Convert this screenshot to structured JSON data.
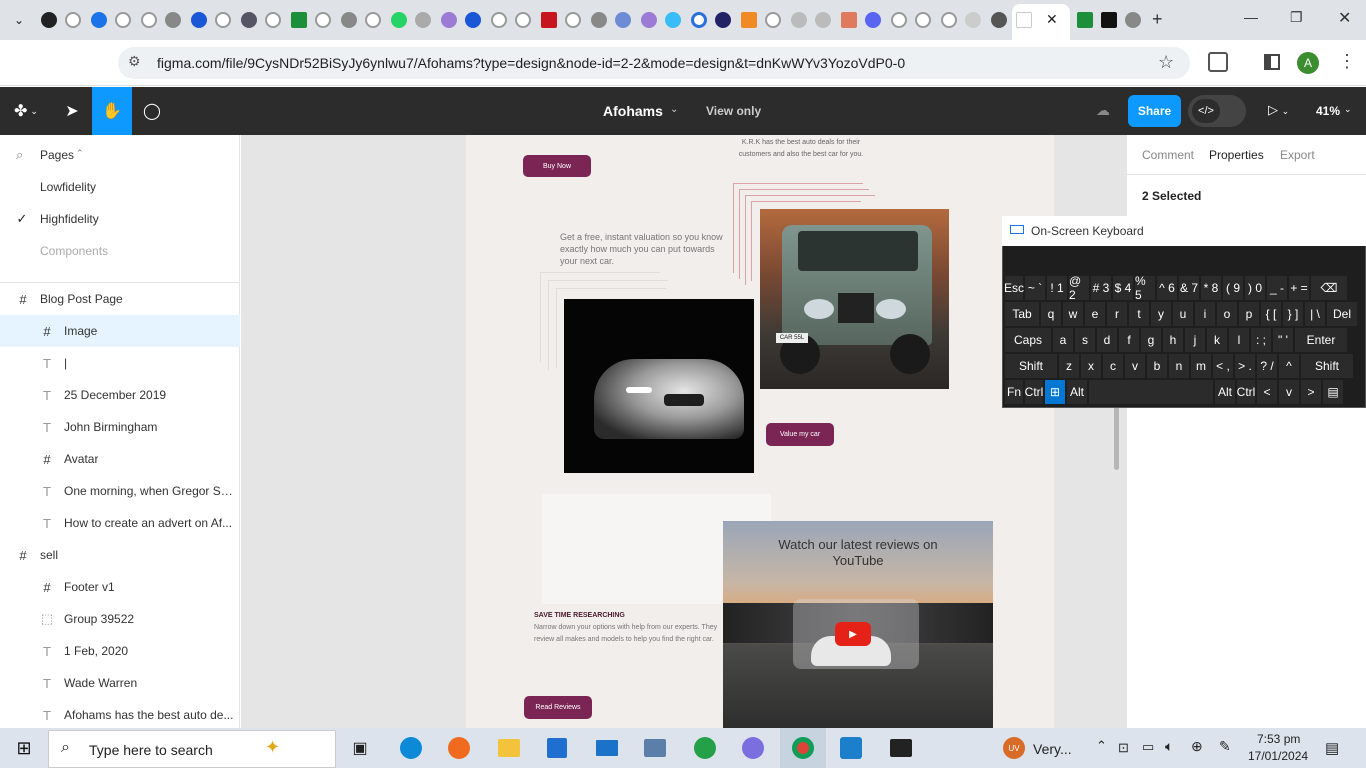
{
  "browser": {
    "url": "figma.com/file/9CysNDr52BiSyJy6ynlwu7/Afohams?type=design&node-id=2-2&mode=design&t=dnKwWYv3YozoVdP0-0",
    "profile_initial": "A",
    "new_tab": "+"
  },
  "figma": {
    "file_name": "Afohams",
    "view_mode": "View only",
    "share_label": "Share",
    "zoom": "41%"
  },
  "left_panel": {
    "pages_label": "Pages",
    "pages": [
      {
        "label": "Lowfidelity",
        "checked": false
      },
      {
        "label": "Highfidelity",
        "checked": true
      },
      {
        "label": "Components",
        "checked": false
      }
    ],
    "layers": [
      {
        "label": "Blog Post Page",
        "type": "frame",
        "level": 0
      },
      {
        "label": "Image",
        "type": "frame",
        "level": 1,
        "selected": true
      },
      {
        "label": "|",
        "type": "text",
        "level": 1
      },
      {
        "label": "25 December 2019",
        "type": "text",
        "level": 1
      },
      {
        "label": "John Birmingham",
        "type": "text",
        "level": 1
      },
      {
        "label": "Avatar",
        "type": "frame",
        "level": 1
      },
      {
        "label": "One morning, when Gregor Sa...",
        "type": "text",
        "level": 1
      },
      {
        "label": "How to create an advert on Af...",
        "type": "text",
        "level": 1
      },
      {
        "label": "sell",
        "type": "frame",
        "level": 0
      },
      {
        "label": "Footer v1",
        "type": "frame",
        "level": 1
      },
      {
        "label": "Group 39522",
        "type": "group",
        "level": 1
      },
      {
        "label": "1 Feb, 2020",
        "type": "text",
        "level": 1
      },
      {
        "label": "Wade Warren",
        "type": "text",
        "level": 1
      },
      {
        "label": "Afohams has the best auto de...",
        "type": "text",
        "level": 1
      }
    ]
  },
  "canvas": {
    "tagline": "K.R.K has the best auto deals for their customers and also the best car for you.",
    "buy_now": "Buy Now",
    "valuation": "Get a free, instant valuation so you know exactly how much you can put towards your next car.",
    "value_my_car": "Value my car",
    "save_time_heading": "SAVE TIME RESEARCHING",
    "save_time_body": "Narrow down your options with help from our experts. They review all makes and models to help you find the right car.",
    "read_reviews": "Read Reviews",
    "youtube_heading": "Watch our latest reviews on YouTube",
    "plate": "CAR 55L"
  },
  "right_panel": {
    "tabs": [
      "Comment",
      "Properties",
      "Export"
    ],
    "active_tab": "Properties",
    "selection": "2 Selected"
  },
  "osk": {
    "title": "On-Screen Keyboard",
    "rows": [
      [
        {
          "k": "Esc"
        },
        {
          "k": "~ `"
        },
        {
          "k": "! 1"
        },
        {
          "k": "@ 2"
        },
        {
          "k": "# 3"
        },
        {
          "k": "$ 4"
        },
        {
          "k": "% 5"
        },
        {
          "k": "^ 6"
        },
        {
          "k": "& 7"
        },
        {
          "k": "* 8"
        },
        {
          "k": "( 9"
        },
        {
          "k": ") 0"
        },
        {
          "k": "_ -"
        },
        {
          "k": "+ ="
        },
        {
          "k": "⌫"
        }
      ],
      [
        {
          "k": "Tab"
        },
        {
          "k": "q"
        },
        {
          "k": "w"
        },
        {
          "k": "e"
        },
        {
          "k": "r"
        },
        {
          "k": "t"
        },
        {
          "k": "y"
        },
        {
          "k": "u"
        },
        {
          "k": "i"
        },
        {
          "k": "o"
        },
        {
          "k": "p"
        },
        {
          "k": "{ ["
        },
        {
          "k": "} ]"
        },
        {
          "k": "| \\"
        },
        {
          "k": "Del"
        }
      ],
      [
        {
          "k": "Caps"
        },
        {
          "k": "a"
        },
        {
          "k": "s"
        },
        {
          "k": "d"
        },
        {
          "k": "f"
        },
        {
          "k": "g"
        },
        {
          "k": "h"
        },
        {
          "k": "j"
        },
        {
          "k": "k"
        },
        {
          "k": "l"
        },
        {
          "k": ": ;"
        },
        {
          "k": "\" '"
        },
        {
          "k": "Enter"
        }
      ],
      [
        {
          "k": "Shift"
        },
        {
          "k": "z"
        },
        {
          "k": "x"
        },
        {
          "k": "c"
        },
        {
          "k": "v"
        },
        {
          "k": "b"
        },
        {
          "k": "n"
        },
        {
          "k": "m"
        },
        {
          "k": "< ,"
        },
        {
          "k": "> ."
        },
        {
          "k": "? /"
        },
        {
          "k": "^"
        },
        {
          "k": "Shift"
        }
      ],
      [
        {
          "k": "Fn"
        },
        {
          "k": "Ctrl"
        },
        {
          "k": "⊞"
        },
        {
          "k": "Alt"
        },
        {
          "k": " "
        },
        {
          "k": "Alt"
        },
        {
          "k": "Ctrl"
        },
        {
          "k": "<"
        },
        {
          "k": "v"
        },
        {
          "k": ">"
        },
        {
          "k": "▤"
        }
      ]
    ]
  },
  "taskbar": {
    "search_placeholder": "Type here to search",
    "weather": "Very...",
    "time": "7:53 pm",
    "date": "17/01/2024",
    "weather_badge": "UV"
  },
  "colors": {
    "accent": "#0d99ff",
    "maroon": "#7a2553",
    "figma_bar": "#2c2c2c"
  }
}
